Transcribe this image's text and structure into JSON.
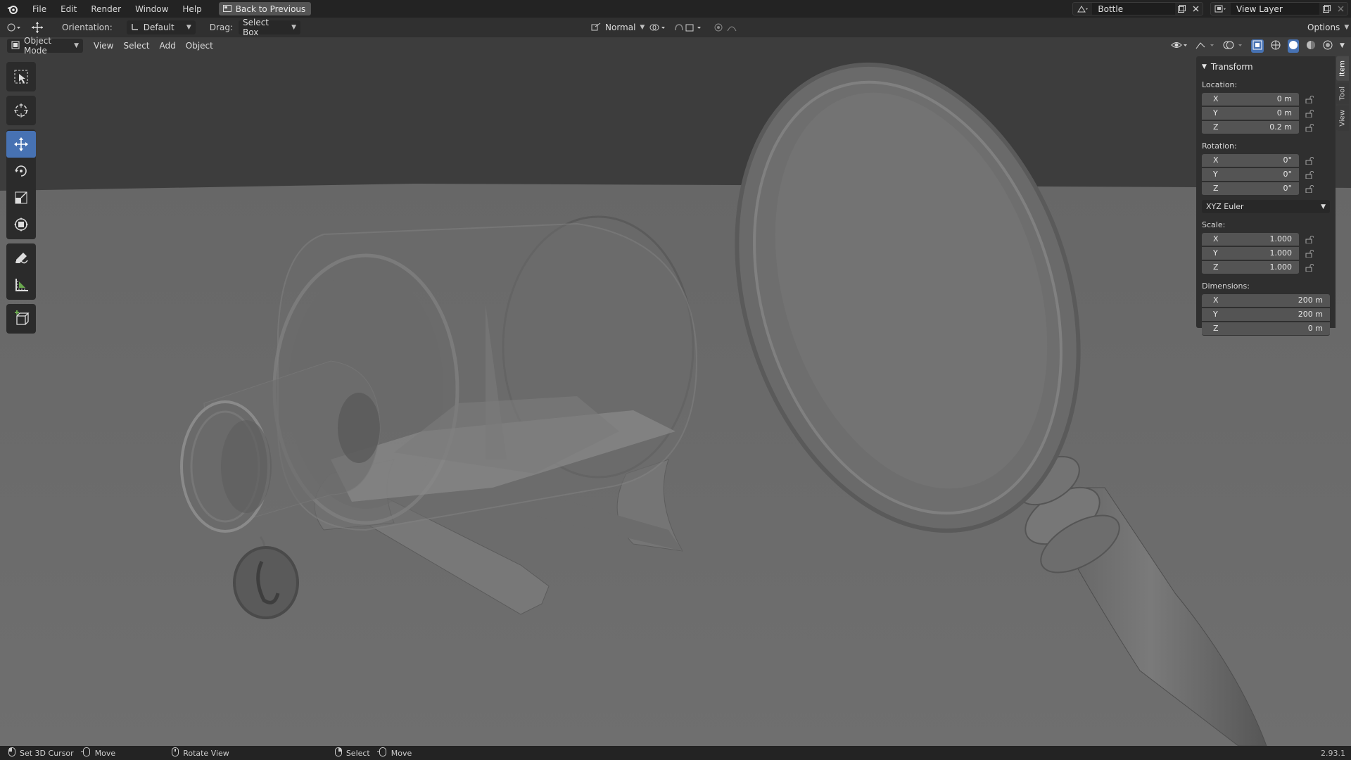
{
  "topbar": {
    "menus": [
      "File",
      "Edit",
      "Render",
      "Window",
      "Help"
    ],
    "back_button": "Back to Previous",
    "scene_name": "Bottle",
    "view_layer_name": "View Layer"
  },
  "toolheader": {
    "orientation_label": "Orientation:",
    "orientation_value": "Default",
    "drag_label": "Drag:",
    "drag_value": "Select Box",
    "transform_orientation": "Normal",
    "options_label": "Options"
  },
  "viewport_header": {
    "mode": "Object Mode",
    "menus": [
      "View",
      "Select",
      "Add",
      "Object"
    ]
  },
  "toolbar": {
    "tools": [
      "select-box",
      "cursor",
      "move",
      "rotate",
      "scale",
      "transform",
      "annotate",
      "measure",
      "add-cube"
    ],
    "active_tool": "move"
  },
  "npanel": {
    "title": "Transform",
    "location_label": "Location:",
    "location": [
      {
        "axis": "X",
        "value": "0 m"
      },
      {
        "axis": "Y",
        "value": "0 m"
      },
      {
        "axis": "Z",
        "value": "0.2 m"
      }
    ],
    "rotation_label": "Rotation:",
    "rotation": [
      {
        "axis": "X",
        "value": "0°"
      },
      {
        "axis": "Y",
        "value": "0°"
      },
      {
        "axis": "Z",
        "value": "0°"
      }
    ],
    "rotation_mode": "XYZ Euler",
    "scale_label": "Scale:",
    "scale": [
      {
        "axis": "X",
        "value": "1.000"
      },
      {
        "axis": "Y",
        "value": "1.000"
      },
      {
        "axis": "Z",
        "value": "1.000"
      }
    ],
    "dimensions_label": "Dimensions:",
    "dimensions": [
      {
        "axis": "X",
        "value": "200 m"
      },
      {
        "axis": "Y",
        "value": "200 m"
      },
      {
        "axis": "Z",
        "value": "0 m"
      }
    ]
  },
  "vtabs": [
    "Item",
    "Tool",
    "View"
  ],
  "statusbar": {
    "set_cursor": "Set 3D Cursor",
    "move1": "Move",
    "rotate_view": "Rotate View",
    "select": "Select",
    "move2": "Move",
    "version": "2.93.1"
  },
  "colors": {
    "accent": "#4772b3",
    "viewport_bg": "#3c3c3c"
  }
}
